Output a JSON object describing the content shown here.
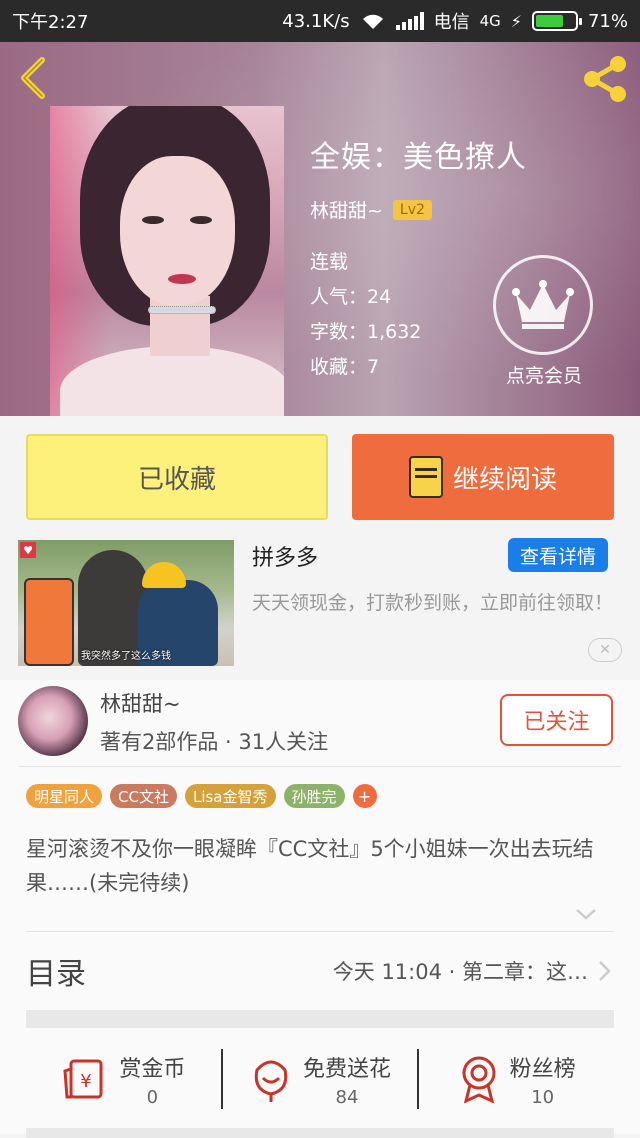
{
  "status_bar": {
    "time": "下午2:27",
    "speed": "43.1K/s",
    "carrier": "电信",
    "network": "4G",
    "battery": "71%",
    "battery_level": 0.71
  },
  "book": {
    "title": "全娱：美色撩人",
    "author": "林甜甜~",
    "level": "Lv2",
    "status": "连载",
    "popularity": "人气：24",
    "word_count": "字数：1,632",
    "favorites": "收藏：7"
  },
  "member": {
    "label": "点亮会员"
  },
  "actions": {
    "collected_label": "已收藏",
    "read_label": "继续阅读"
  },
  "ad": {
    "title": "拼多多",
    "detail_label": "查看详情",
    "description": "天天领现金，打款秒到账，立即前往领取！",
    "image_caption": "我突然多了这么多钱"
  },
  "author": {
    "name": "林甜甜~",
    "stats": "著有2部作品 · 31人关注",
    "follow_label": "已关注"
  },
  "tags": [
    {
      "label": "明星同人",
      "color": "#f0a23c"
    },
    {
      "label": "CC文社",
      "color": "#c97a5f"
    },
    {
      "label": "Lisa金智秀",
      "color": "#d4a13a"
    },
    {
      "label": "孙胜完",
      "color": "#8fb26b"
    }
  ],
  "tag_add_label": "+",
  "synopsis": "星河滚烫不及你一眼凝眸『CC文社』5个小姐妹一次出去玩结果……(未完待续)",
  "toc": {
    "title": "目录",
    "latest": "今天 11:04 · 第二章：这…"
  },
  "stats": [
    {
      "label": "赏金币",
      "value": "0",
      "icon": "reward-coin-icon"
    },
    {
      "label": "免费送花",
      "value": "84",
      "icon": "flower-icon"
    },
    {
      "label": "粉丝榜",
      "value": "10",
      "icon": "medal-icon"
    }
  ],
  "colors": {
    "accent": "#ee6c3d",
    "collected_bg": "#fef17b",
    "ad_button": "#1a7ee8",
    "follow": "#e2533a"
  }
}
